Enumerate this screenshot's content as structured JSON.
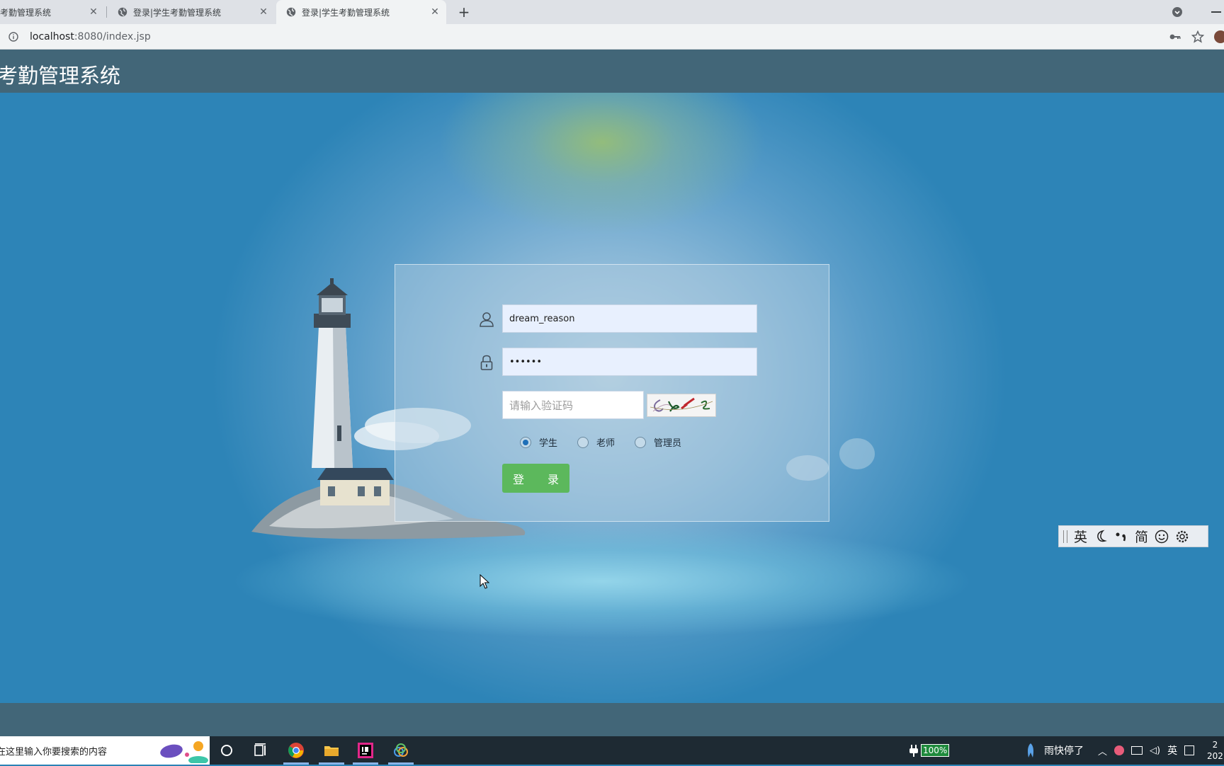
{
  "browser": {
    "tabs": [
      {
        "title": "考勤管理系统",
        "active": false
      },
      {
        "title": "登录|学生考勤管理系统",
        "active": false
      },
      {
        "title": "登录|学生考勤管理系统",
        "active": true
      }
    ],
    "url_host": "localhost",
    "url_rest": ":8080/index.jsp"
  },
  "page": {
    "header_title": "考勤管理系统",
    "login": {
      "username_value": "dream_reason",
      "password_value": "••••••",
      "captcha_placeholder": "请输入验证码",
      "roles": [
        {
          "label": "学生",
          "checked": true
        },
        {
          "label": "老师",
          "checked": false
        },
        {
          "label": "管理员",
          "checked": false
        }
      ],
      "submit_label": "登 录"
    }
  },
  "ime_toolbar": {
    "mode": "英",
    "script": "简"
  },
  "taskbar": {
    "search_text": "在这里输入你要搜索的内容",
    "battery": "100%",
    "weather": "雨快停了",
    "ime_indicator": "英",
    "clock_time": "2",
    "clock_date": "202"
  },
  "colors": {
    "header_bg": "#426678",
    "scene_bg": "#2b82b5",
    "login_button": "#5cb85c",
    "input_bg": "#e8f0fe"
  }
}
